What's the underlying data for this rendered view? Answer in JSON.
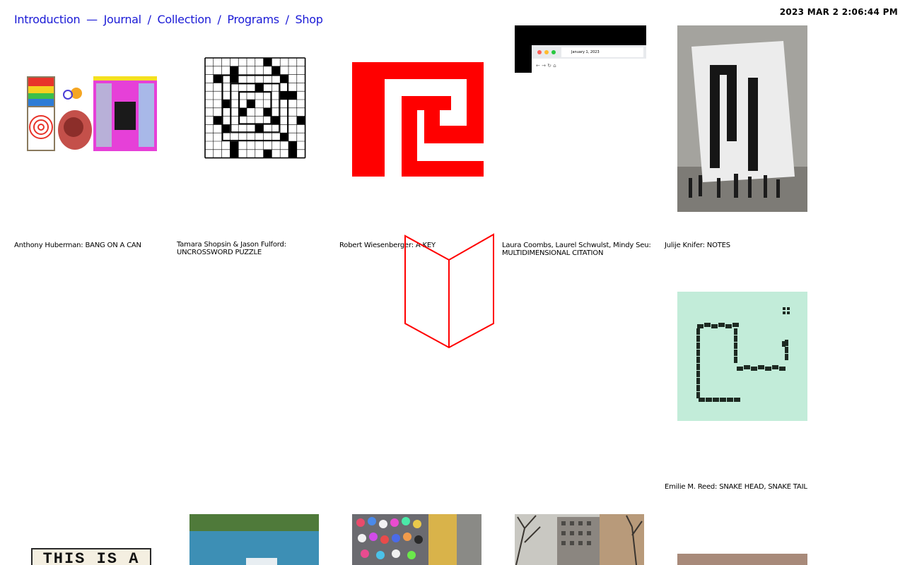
{
  "nav": {
    "intro": "Introduction",
    "dash": "—",
    "journal": "Journal",
    "slash": "/",
    "collection": "Collection",
    "programs": "Programs",
    "shop": "Shop"
  },
  "clock": "2023 MAR 2 2:06:44 PM",
  "works": [
    {
      "caption": "Anthony Huberman: BANG ON A CAN"
    },
    {
      "caption": "Tamara Shopsin & Jason Fulford: UNCROSSWORD PUZZLE"
    },
    {
      "caption": "Robert Wiesenberger: A KEY"
    },
    {
      "caption": "Laura Coombs, Laurel Schwulst, Mindy Seu: MULTIDIMENSIONAL CITATION"
    },
    {
      "caption": "Julije Knifer: NOTES"
    },
    {
      "caption": "Emilie M. Reed: SNAKE HEAD, SNAKE TAIL"
    }
  ],
  "browser_tab": "January 1, 2023",
  "sign_text": "THIS IS A",
  "colors": {
    "nav": "#1a1ad6",
    "key_red": "#ff0000",
    "snake_bg": "#c2ecd9"
  }
}
